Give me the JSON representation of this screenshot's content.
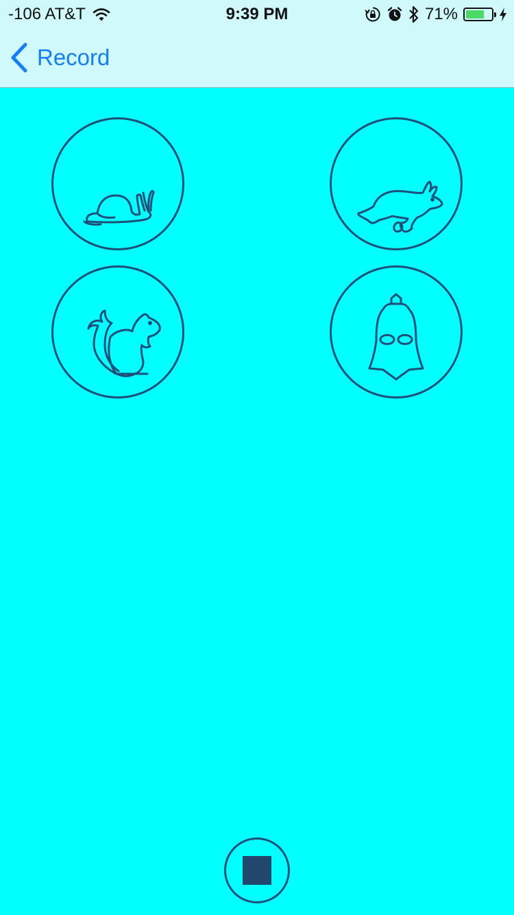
{
  "status_bar": {
    "carrier": "-106 AT&T",
    "time": "9:39 PM",
    "battery_percent_label": "71%",
    "battery_level": 0.71,
    "icons": [
      "wifi-icon",
      "orientation-lock-icon",
      "alarm-icon",
      "bluetooth-icon",
      "battery-icon",
      "charging-icon"
    ]
  },
  "nav": {
    "back_label": "Record"
  },
  "effects": [
    {
      "id": "snail",
      "icon": "snail-icon"
    },
    {
      "id": "rabbit",
      "icon": "rabbit-icon"
    },
    {
      "id": "squirrel",
      "icon": "squirrel-icon"
    },
    {
      "id": "vader",
      "icon": "darth-vader-helmet-icon"
    }
  ],
  "controls": {
    "stop_icon": "stop-icon"
  },
  "colors": {
    "background": "#00FFFF",
    "nav_background": "#CFF9FA",
    "accent": "#147EFB",
    "icon_stroke": "#1F4F78",
    "stop_fill": "#23466C",
    "battery_fill": "#4CD964"
  }
}
